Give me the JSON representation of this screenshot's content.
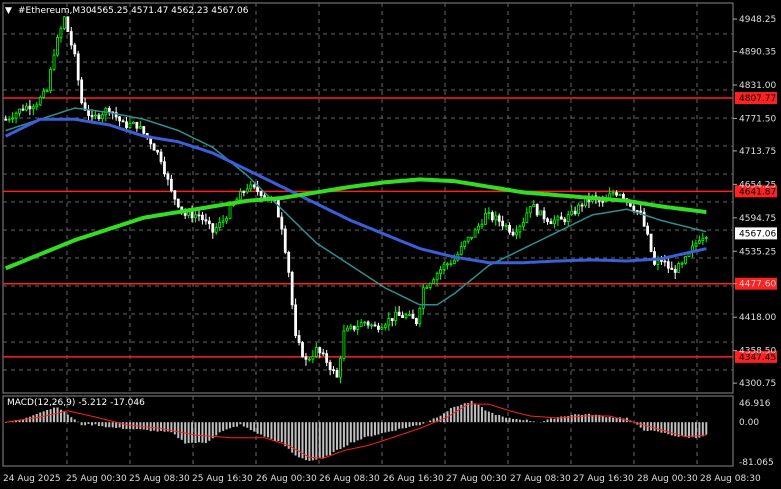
{
  "chart_header": {
    "arrow": "▼",
    "symbol": "#Ethereum,M30",
    "ohlc": "4565.25 4571.47 4562.23 4567.06"
  },
  "price_axis": {
    "ticks": [
      "4948.25",
      "4890.35",
      "4831.00",
      "4771.50",
      "4713.75",
      "4654.25",
      "4594.75",
      "4535.25",
      "4477.60",
      "4418.00",
      "4358.50",
      "4300.75"
    ],
    "ylim": [
      4285,
      4975
    ]
  },
  "current_price": "4567.06",
  "levels": [
    {
      "label": "4807.77",
      "value": 4807.77
    },
    {
      "label": "4641.87",
      "value": 4641.87
    },
    {
      "label": "4477.60",
      "value": 4477.6
    },
    {
      "label": "4347.45",
      "value": 4347.45
    }
  ],
  "macd": {
    "header": "MACD(12,26,9) -5.212 -17.046",
    "ticks": [
      "46.916",
      "0.00",
      "-81.065"
    ]
  },
  "time_axis": [
    "24 Aug 2025",
    "25 Aug 00:30",
    "25 Aug 08:30",
    "25 Aug 16:30",
    "26 Aug 00:30",
    "26 Aug 08:30",
    "26 Aug 16:30",
    "27 Aug 00:30",
    "27 Aug 08:30",
    "27 Aug 16:30",
    "28 Aug 00:30",
    "28 Aug 08:30"
  ],
  "colors": {
    "background": "#000000",
    "bull_candle": "#00ff00",
    "bear_candle": "#ffffff",
    "ma_fast": "#2f8f8f",
    "ma_mid": "#3a5fd9",
    "ma_slow": "#33dd22",
    "level_line": "#ff2020",
    "macd_hist": "#c0c0c0",
    "macd_signal": "#ff2020"
  },
  "chart_data": {
    "type": "candlestick",
    "y_range": [
      4285,
      4975
    ],
    "price_anchors": [
      [
        0,
        4770
      ],
      [
        5,
        4790
      ],
      [
        9,
        4800
      ],
      [
        12,
        4820
      ],
      [
        14,
        4890
      ],
      [
        17,
        4950
      ],
      [
        20,
        4880
      ],
      [
        22,
        4800
      ],
      [
        25,
        4770
      ],
      [
        30,
        4790
      ],
      [
        34,
        4760
      ],
      [
        38,
        4760
      ],
      [
        42,
        4730
      ],
      [
        45,
        4700
      ],
      [
        48,
        4640
      ],
      [
        52,
        4600
      ],
      [
        56,
        4600
      ],
      [
        60,
        4570
      ],
      [
        63,
        4590
      ],
      [
        66,
        4620
      ],
      [
        70,
        4650
      ],
      [
        74,
        4640
      ],
      [
        78,
        4620
      ],
      [
        80,
        4580
      ],
      [
        82,
        4500
      ],
      [
        84,
        4380
      ],
      [
        87,
        4340
      ],
      [
        90,
        4360
      ],
      [
        93,
        4340
      ],
      [
        96,
        4310
      ],
      [
        98,
        4390
      ],
      [
        101,
        4400
      ],
      [
        104,
        4410
      ],
      [
        107,
        4400
      ],
      [
        110,
        4410
      ],
      [
        113,
        4420
      ],
      [
        116,
        4420
      ],
      [
        119,
        4410
      ],
      [
        121,
        4470
      ],
      [
        124,
        4490
      ],
      [
        127,
        4510
      ],
      [
        130,
        4520
      ],
      [
        133,
        4550
      ],
      [
        136,
        4570
      ],
      [
        139,
        4600
      ],
      [
        143,
        4590
      ],
      [
        147,
        4570
      ],
      [
        150,
        4590
      ],
      [
        152,
        4620
      ],
      [
        155,
        4600
      ],
      [
        158,
        4590
      ],
      [
        161,
        4590
      ],
      [
        164,
        4600
      ],
      [
        167,
        4620
      ],
      [
        170,
        4630
      ],
      [
        173,
        4620
      ],
      [
        176,
        4640
      ],
      [
        178,
        4640
      ],
      [
        181,
        4620
      ],
      [
        184,
        4600
      ],
      [
        186,
        4560
      ],
      [
        188,
        4510
      ],
      [
        190,
        4520
      ],
      [
        193,
        4500
      ],
      [
        196,
        4510
      ],
      [
        199,
        4540
      ],
      [
        201,
        4560
      ],
      [
        203,
        4567
      ]
    ],
    "ma_fast": [
      [
        0,
        4750
      ],
      [
        10,
        4770
      ],
      [
        20,
        4790
      ],
      [
        30,
        4782
      ],
      [
        40,
        4770
      ],
      [
        50,
        4750
      ],
      [
        60,
        4720
      ],
      [
        70,
        4670
      ],
      [
        80,
        4610
      ],
      [
        90,
        4550
      ],
      [
        100,
        4510
      ],
      [
        110,
        4470
      ],
      [
        120,
        4440
      ],
      [
        125,
        4440
      ],
      [
        130,
        4460
      ],
      [
        140,
        4510
      ],
      [
        150,
        4540
      ],
      [
        160,
        4570
      ],
      [
        170,
        4600
      ],
      [
        180,
        4610
      ],
      [
        190,
        4590
      ],
      [
        203,
        4570
      ]
    ],
    "ma_mid": [
      [
        0,
        4740
      ],
      [
        10,
        4770
      ],
      [
        20,
        4770
      ],
      [
        30,
        4760
      ],
      [
        40,
        4740
      ],
      [
        50,
        4730
      ],
      [
        60,
        4710
      ],
      [
        70,
        4680
      ],
      [
        80,
        4650
      ],
      [
        90,
        4620
      ],
      [
        100,
        4590
      ],
      [
        110,
        4565
      ],
      [
        120,
        4540
      ],
      [
        130,
        4525
      ],
      [
        140,
        4515
      ],
      [
        150,
        4515
      ],
      [
        160,
        4518
      ],
      [
        170,
        4520
      ],
      [
        180,
        4518
      ],
      [
        190,
        4522
      ],
      [
        203,
        4540
      ]
    ],
    "ma_slow": [
      [
        0,
        4505
      ],
      [
        10,
        4530
      ],
      [
        20,
        4555
      ],
      [
        30,
        4575
      ],
      [
        40,
        4595
      ],
      [
        50,
        4605
      ],
      [
        60,
        4615
      ],
      [
        70,
        4625
      ],
      [
        80,
        4630
      ],
      [
        90,
        4640
      ],
      [
        100,
        4650
      ],
      [
        110,
        4658
      ],
      [
        120,
        4663
      ],
      [
        130,
        4660
      ],
      [
        140,
        4650
      ],
      [
        150,
        4640
      ],
      [
        160,
        4635
      ],
      [
        170,
        4630
      ],
      [
        180,
        4625
      ],
      [
        190,
        4615
      ],
      [
        203,
        4605
      ]
    ],
    "macd_hist_anchors": [
      [
        0,
        0
      ],
      [
        5,
        5
      ],
      [
        10,
        20
      ],
      [
        15,
        30
      ],
      [
        18,
        15
      ],
      [
        22,
        -5
      ],
      [
        26,
        -5
      ],
      [
        30,
        -10
      ],
      [
        40,
        -15
      ],
      [
        48,
        -20
      ],
      [
        52,
        -40
      ],
      [
        58,
        -40
      ],
      [
        62,
        -20
      ],
      [
        68,
        -5
      ],
      [
        74,
        -25
      ],
      [
        80,
        -40
      ],
      [
        84,
        -65
      ],
      [
        88,
        -75
      ],
      [
        92,
        -70
      ],
      [
        96,
        -55
      ],
      [
        100,
        -40
      ],
      [
        105,
        -28
      ],
      [
        110,
        -20
      ],
      [
        115,
        -12
      ],
      [
        120,
        -5
      ],
      [
        125,
        10
      ],
      [
        130,
        30
      ],
      [
        135,
        40
      ],
      [
        140,
        20
      ],
      [
        145,
        8
      ],
      [
        150,
        5
      ],
      [
        155,
        0
      ],
      [
        160,
        10
      ],
      [
        165,
        15
      ],
      [
        170,
        15
      ],
      [
        175,
        10
      ],
      [
        180,
        8
      ],
      [
        185,
        -15
      ],
      [
        190,
        -20
      ],
      [
        195,
        -28
      ],
      [
        200,
        -30
      ],
      [
        203,
        -25
      ]
    ],
    "macd_signal_anchors": [
      [
        0,
        0
      ],
      [
        10,
        10
      ],
      [
        18,
        22
      ],
      [
        26,
        10
      ],
      [
        35,
        -5
      ],
      [
        45,
        -12
      ],
      [
        55,
        -25
      ],
      [
        65,
        -30
      ],
      [
        75,
        -30
      ],
      [
        82,
        -45
      ],
      [
        88,
        -68
      ],
      [
        92,
        -70
      ],
      [
        98,
        -55
      ],
      [
        105,
        -45
      ],
      [
        112,
        -30
      ],
      [
        120,
        -12
      ],
      [
        128,
        10
      ],
      [
        134,
        35
      ],
      [
        140,
        35
      ],
      [
        146,
        22
      ],
      [
        152,
        12
      ],
      [
        160,
        8
      ],
      [
        168,
        12
      ],
      [
        175,
        12
      ],
      [
        182,
        0
      ],
      [
        190,
        -15
      ],
      [
        197,
        -28
      ],
      [
        203,
        -25
      ]
    ],
    "macd_range": [
      -81.065,
      46.916
    ]
  }
}
